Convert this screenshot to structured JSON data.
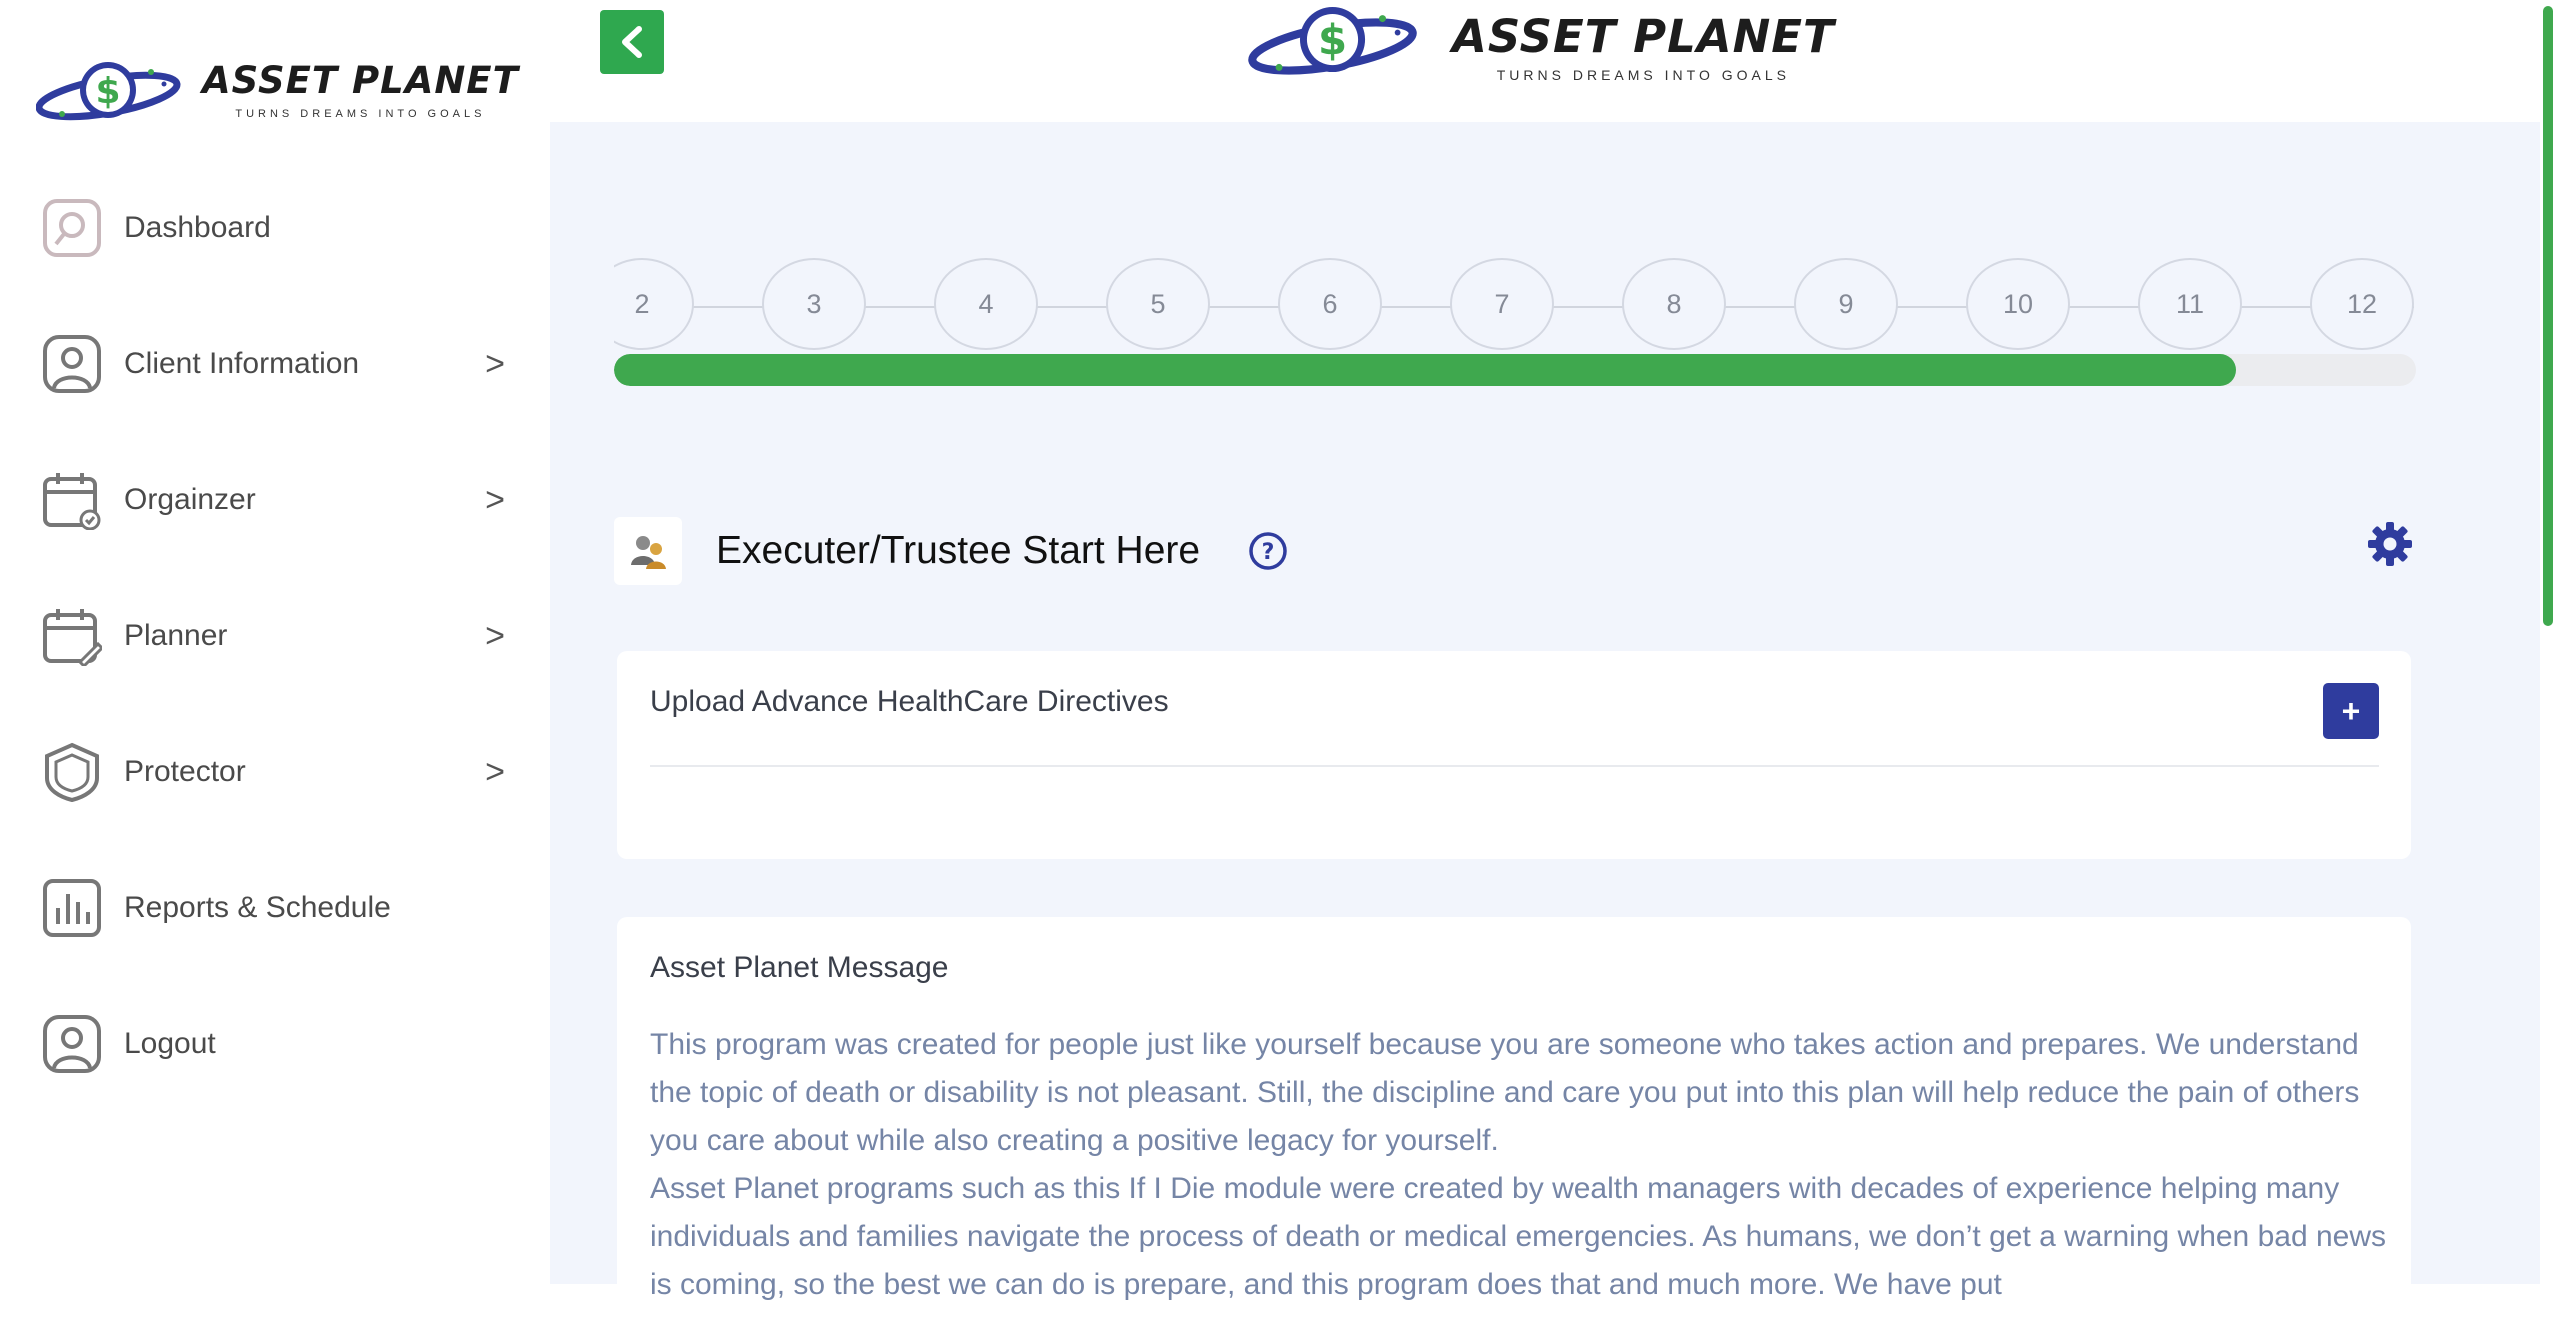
{
  "brand": {
    "name": "ASSET PLANET",
    "tagline": "TURNS DREAMS INTO GOALS",
    "colors": {
      "green": "#3fa84e",
      "navy": "#2f3c9e",
      "background": "#f2f5fc"
    }
  },
  "sidebar": {
    "items": [
      {
        "label": "Dashboard",
        "icon": "dashboard-gauge-icon",
        "has_submenu": false
      },
      {
        "label": "Client Information",
        "icon": "user-icon",
        "has_submenu": true
      },
      {
        "label": "Orgainzer",
        "icon": "calendar-check-icon",
        "has_submenu": true
      },
      {
        "label": "Planner",
        "icon": "calendar-edit-icon",
        "has_submenu": true
      },
      {
        "label": "Protector",
        "icon": "shield-icon",
        "has_submenu": true
      },
      {
        "label": "Reports & Schedule",
        "icon": "bar-chart-icon",
        "has_submenu": false
      },
      {
        "label": "Logout",
        "icon": "user-logout-icon",
        "has_submenu": false
      }
    ],
    "chevron": ">"
  },
  "header": {
    "back_icon": "chevron-left-icon"
  },
  "stepper": {
    "steps": [
      "2",
      "3",
      "4",
      "5",
      "6",
      "7",
      "8",
      "9",
      "10",
      "11",
      "12"
    ],
    "progress_fraction": 0.9
  },
  "section": {
    "title": "Executer/Trustee Start Here",
    "help_icon": "question-circle-icon",
    "settings_icon": "gear-icon"
  },
  "upload_card": {
    "title": "Upload Advance HealthCare Directives",
    "add_label": "+"
  },
  "message_card": {
    "title": "Asset Planet Message",
    "paragraphs": [
      "This program was created for people just like yourself because you are someone who takes action and prepares. We understand the topic of death or disability is not pleasant. Still, the discipline and care you put into this plan will help reduce the pain of others you care about while also creating a positive legacy for yourself.",
      "Asset Planet programs such as this If I Die module were created by wealth managers with decades of experience helping many individuals and families navigate the process of death or medical emergencies. As humans, we don’t get a warning when bad news is coming, so the best we can do is prepare, and this program does that and much more. We have put"
    ]
  }
}
